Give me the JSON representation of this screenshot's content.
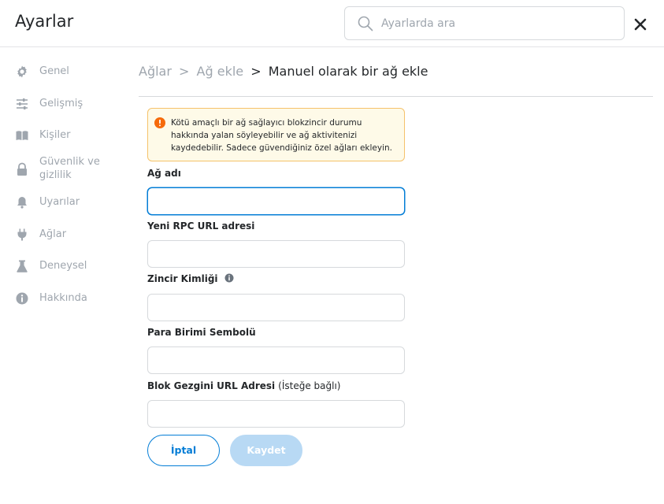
{
  "header": {
    "title": "Ayarlar",
    "search_placeholder": "Ayarlarda ara"
  },
  "sidebar": {
    "items": [
      {
        "label": "Genel",
        "icon": "gear-icon"
      },
      {
        "label": "Gelişmiş",
        "icon": "sliders-icon"
      },
      {
        "label": "Kişiler",
        "icon": "book-icon"
      },
      {
        "label": "Güvenlik ve gizlilik",
        "icon": "lock-icon"
      },
      {
        "label": "Uyarılar",
        "icon": "bell-icon"
      },
      {
        "label": "Ağlar",
        "icon": "plug-icon"
      },
      {
        "label": "Deneysel",
        "icon": "flask-icon"
      },
      {
        "label": "Hakkında",
        "icon": "info-icon"
      }
    ]
  },
  "breadcrumb": {
    "items": [
      "Ağlar",
      "Ağ ekle"
    ],
    "separator": ">",
    "current": "Manuel olarak bir ağ ekle"
  },
  "warning": {
    "text": "Kötü amaçlı bir ağ sağlayıcı blokzincir durumu hakkında yalan söyleyebilir ve ağ aktivitenizi kaydedebilir. Sadece güvendiğiniz özel ağları ekleyin."
  },
  "form": {
    "network_name": {
      "label": "Ağ adı",
      "value": ""
    },
    "rpc_url": {
      "label": "Yeni RPC URL adresi",
      "value": ""
    },
    "chain_id": {
      "label": "Zincir Kimliği",
      "value": ""
    },
    "currency_symbol": {
      "label": "Para Birimi Sembolü",
      "value": ""
    },
    "explorer_url": {
      "label": "Blok Gezgini URL Adresi",
      "optional": "(İsteğe bağlı)",
      "value": ""
    }
  },
  "buttons": {
    "cancel": "İptal",
    "save": "Kaydet"
  },
  "colors": {
    "primary": "#037dd6",
    "disabled_primary": "#b8d9f4",
    "warning_bg": "#fefae8",
    "warning_border": "#f5c26b",
    "warning_icon": "#f66a0a",
    "muted_text": "#9fa6ae"
  }
}
